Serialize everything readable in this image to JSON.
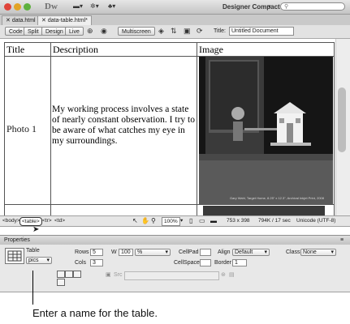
{
  "app": {
    "logo": "Dw",
    "workspace": "Designer Compact",
    "search_placeholder": ""
  },
  "tabs": [
    {
      "label": "data.html"
    },
    {
      "label": "data-table.html*"
    }
  ],
  "doc_toolbar": {
    "code": "Code",
    "split": "Split",
    "design": "Design",
    "live": "Live",
    "multiscreen": "Multiscreen",
    "title_label": "Title:",
    "title_value": "Untitled Document"
  },
  "table": {
    "headers": [
      "Title",
      "Description",
      "Image"
    ],
    "row1": {
      "title": "Photo 1",
      "description": "My working process involves a state of nearly constant observation.  I try to be aware of what catches my eye in my surroundings.",
      "caption": "Gary Wahl, Target Home, 8.25\" x 12.3\", Archival Inkjet Print, 2008"
    }
  },
  "status_bar": {
    "body_tag": "<body>",
    "table_tag": "<table>",
    "tr_tag": "<tr>",
    "td_tag": "<td>",
    "zoom": "100%",
    "dimensions": "753 x 398",
    "download": "794K / 17 sec",
    "encoding": "Unicode (UTF-8)"
  },
  "properties": {
    "header": "Properties",
    "table_label": "Table",
    "table_name": "pics",
    "rows_label": "Rows",
    "rows_value": "5",
    "cols_label": "Cols",
    "cols_value": "3",
    "w_label": "W",
    "w_value": "100",
    "w_unit": "%",
    "cellpad_label": "CellPad",
    "cellspace_label": "CellSpace",
    "align_label": "Align",
    "align_value": "Default",
    "border_label": "Border",
    "border_value": "1",
    "class_label": "Class",
    "class_value": "None",
    "src_label": "Src"
  },
  "callout": "Enter a name for the table."
}
